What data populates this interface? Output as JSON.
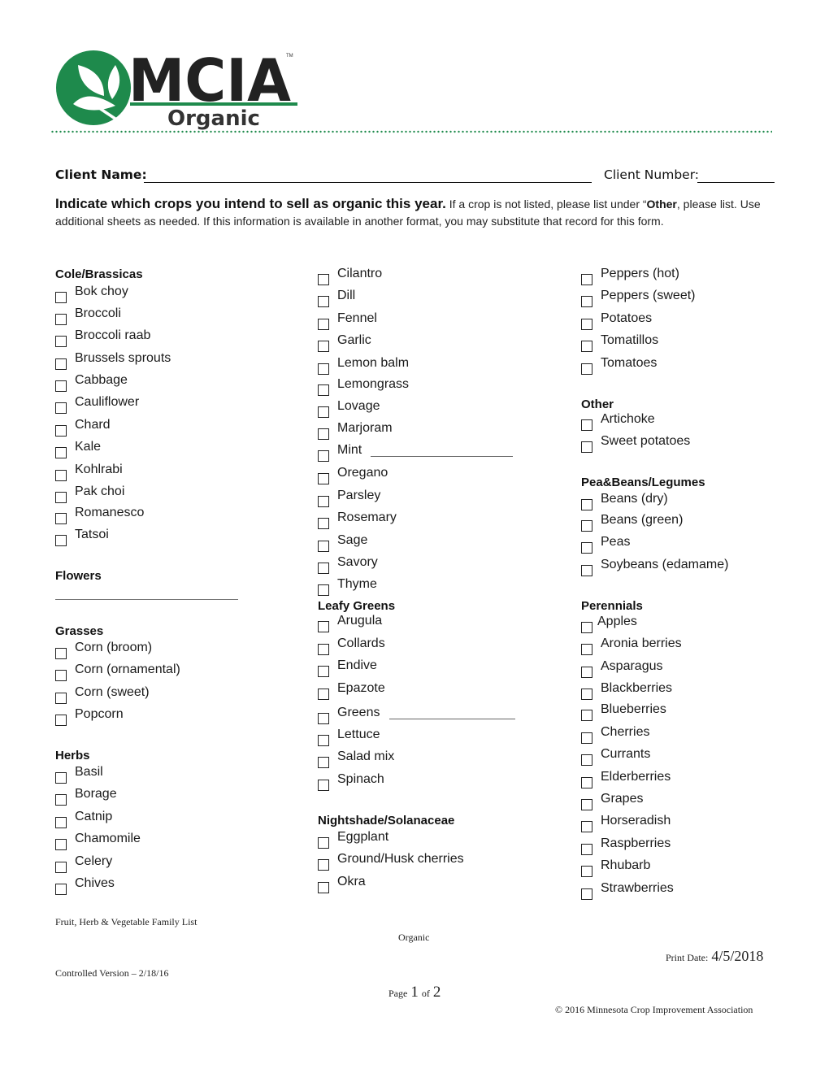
{
  "logo": {
    "brand": "MCIA",
    "trademark": "TM",
    "subtitle": "Organic",
    "brand_color": "#1e8a4c",
    "text_color": "#222222"
  },
  "client": {
    "name_label": "Client Name:",
    "name_value": "",
    "number_label": "Client Number:",
    "number_value": ""
  },
  "instructions": {
    "lead": "Indicate which crops you intend to sell as organic this year.",
    "text_1": "  If a crop is not listed, please list under “",
    "bold_word": "Other",
    "text_2": ", please list.  Use additional sheets as needed.  If this information is available in another format, you may substitute that record for this form."
  },
  "columns": [
    {
      "sections": [
        {
          "title": "Cole/Brassicas",
          "items": [
            "Bok choy",
            "Broccoli",
            "Broccoli raab",
            "Brussels sprouts",
            "Cabbage",
            "Cauliflower",
            "Chard",
            "Kale",
            "Kohlrabi",
            "Pak choi",
            "Romanesco",
            "Tatsoi"
          ]
        },
        {
          "title": "Flowers",
          "items": []
        },
        {
          "title": "Grasses",
          "items": [
            "Corn (broom)",
            "Corn (ornamental)",
            "Corn (sweet)",
            "Popcorn"
          ]
        },
        {
          "title": "Herbs",
          "items": [
            "Basil",
            "Borage",
            "Catnip",
            "Chamomile",
            "Celery",
            "Chives"
          ]
        }
      ]
    },
    {
      "sections": [
        {
          "title": "",
          "items": [
            "Cilantro",
            "Dill",
            "Fennel",
            "Garlic",
            "Lemon balm",
            "Lemongrass",
            "Lovage",
            "Marjoram",
            "Mint",
            "Oregano",
            "Parsley",
            "Rosemary",
            "Sage",
            "Savory",
            "Thyme"
          ]
        },
        {
          "title": "Leafy Greens",
          "items": [
            "Arugula",
            "Collards",
            "Endive",
            "Epazote",
            "Greens",
            "Lettuce",
            "Salad mix",
            "Spinach"
          ]
        },
        {
          "title": "Nightshade/Solanaceae",
          "items": [
            "Eggplant",
            "Ground/Husk cherries",
            "Okra"
          ]
        }
      ]
    },
    {
      "sections": [
        {
          "title": "",
          "items": [
            "Peppers (hot)",
            "Peppers (sweet)",
            "Potatoes",
            "Tomatillos",
            "Tomatoes"
          ]
        },
        {
          "title": "Other",
          "items": [
            "Artichoke",
            "Sweet potatoes"
          ]
        },
        {
          "title": "Pea&Beans/Legumes",
          "items": [
            "Beans (dry)",
            "Beans (green)",
            "Peas",
            "Soybeans (edamame)"
          ]
        },
        {
          "title": "Perennials",
          "items": [
            "Apples",
            "Aronia berries",
            "Asparagus",
            "Blackberries",
            "Blueberries",
            "Cherries",
            "Currants",
            "Elderberries",
            "Grapes",
            "Horseradish",
            "Raspberries",
            "Rhubarb",
            "Strawberries"
          ]
        }
      ]
    }
  ],
  "footer": {
    "doc_title": "Fruit, Herb & Vegetable Family List",
    "program": "Organic",
    "print_date_label": "Print Date:",
    "print_date": "4/5/2018",
    "version": "Controlled Version – 2/18/16",
    "page_label": "Page",
    "page_current": "1",
    "page_of": "of",
    "page_total": "2",
    "copyright": "© 2016 Minnesota Crop Improvement Association"
  }
}
